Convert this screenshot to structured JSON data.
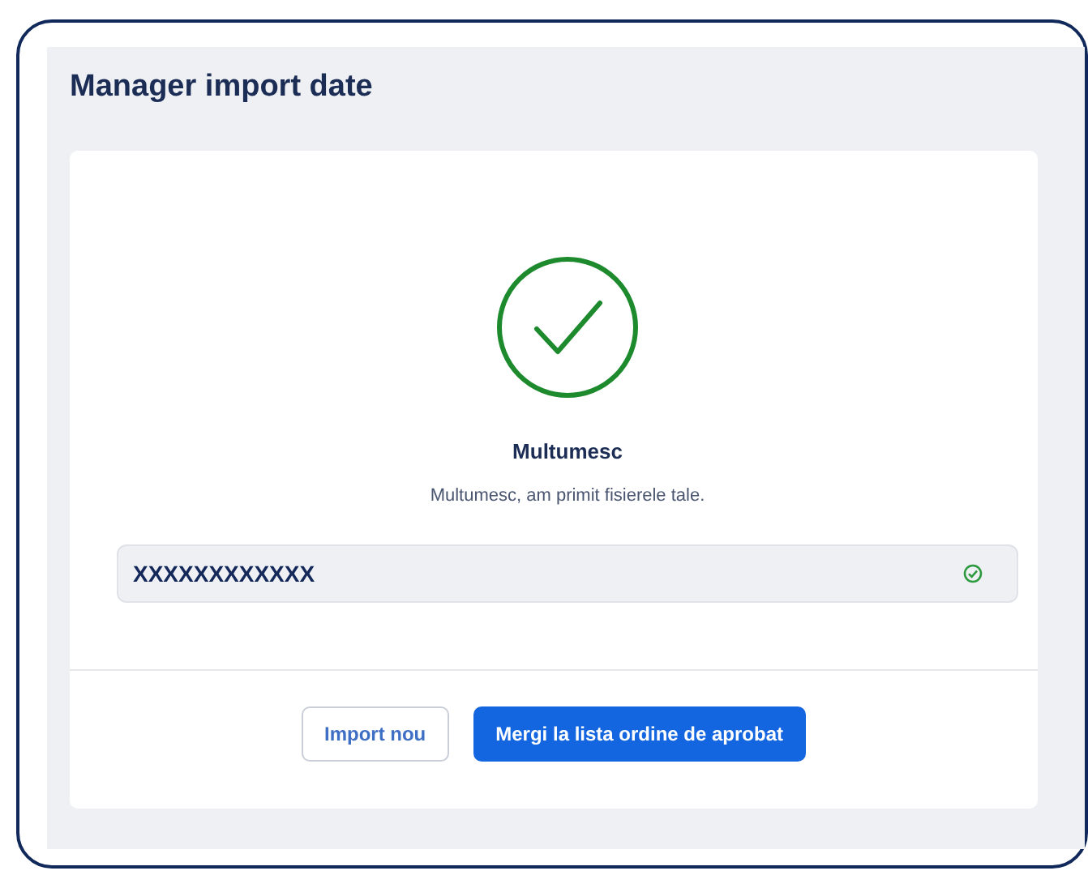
{
  "page": {
    "title": "Manager import date"
  },
  "result": {
    "heading": "Multumesc",
    "message": "Multumesc, am primit fisierele tale."
  },
  "field": {
    "value": "XXXXXXXXXXXX",
    "valid": true
  },
  "buttons": [
    {
      "label": "Import nou",
      "kind": "secondary"
    },
    {
      "label": "Mergi la lista ordine de aprobat",
      "kind": "primary"
    }
  ]
}
